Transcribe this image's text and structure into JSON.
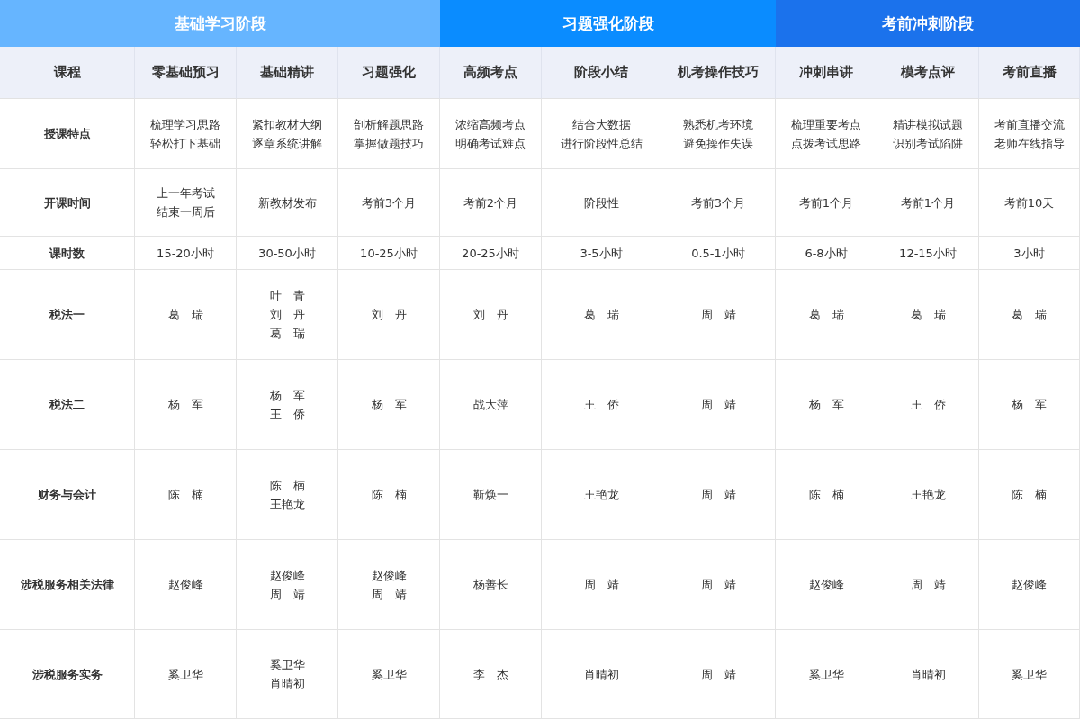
{
  "phases": [
    {
      "title": "基础学习阶段",
      "color": "#66b5ff",
      "columns": [
        "课程",
        "零基础预习",
        "基础精讲",
        "习题强化"
      ]
    },
    {
      "title": "习题强化阶段",
      "color": "#0a8cff",
      "columns": [
        "高频考点",
        "阶段小结",
        "机考操作技巧"
      ]
    },
    {
      "title": "考前冲刺阶段",
      "color": "#1b72ec",
      "columns": [
        "冲刺串讲",
        "模考点评",
        "考前直播"
      ]
    }
  ],
  "rows": [
    {
      "label": "授课特点",
      "cells": [
        [
          "梳理学习思路",
          "轻松打下基础"
        ],
        [
          "紧扣教材大纲",
          "逐章系统讲解"
        ],
        [
          "剖析解题思路",
          "掌握做题技巧"
        ],
        [
          "浓缩高频考点",
          "明确考试难点"
        ],
        [
          "结合大数据",
          "进行阶段性总结"
        ],
        [
          "熟悉机考环境",
          "避免操作失误"
        ],
        [
          "梳理重要考点",
          "点拨考试思路"
        ],
        [
          "精讲模拟试题",
          "识别考试陷阱"
        ],
        [
          "考前直播交流",
          "老师在线指导"
        ]
      ]
    },
    {
      "label": "开课时间",
      "cells": [
        [
          "上一年考试",
          "结束一周后"
        ],
        [
          "新教材发布"
        ],
        [
          "考前3个月"
        ],
        [
          "考前2个月"
        ],
        [
          "阶段性"
        ],
        [
          "考前3个月"
        ],
        [
          "考前1个月"
        ],
        [
          "考前1个月"
        ],
        [
          "考前10天"
        ]
      ]
    },
    {
      "label": "课时数",
      "cells": [
        [
          "15-20小时"
        ],
        [
          "30-50小时"
        ],
        [
          "10-25小时"
        ],
        [
          "20-25小时"
        ],
        [
          "3-5小时"
        ],
        [
          "0.5-1小时"
        ],
        [
          "6-8小时"
        ],
        [
          "12-15小时"
        ],
        [
          "3小时"
        ]
      ]
    },
    {
      "label": "税法一",
      "cells": [
        [
          "葛　瑞"
        ],
        [
          "叶　青",
          "刘　丹",
          "葛　瑞"
        ],
        [
          "刘　丹"
        ],
        [
          "刘　丹"
        ],
        [
          "葛　瑞"
        ],
        [
          "周　靖"
        ],
        [
          "葛　瑞"
        ],
        [
          "葛　瑞"
        ],
        [
          "葛　瑞"
        ]
      ]
    },
    {
      "label": "税法二",
      "cells": [
        [
          "杨　军"
        ],
        [
          "杨　军",
          "王　侨"
        ],
        [
          "杨　军"
        ],
        [
          "战大萍"
        ],
        [
          "王　侨"
        ],
        [
          "周　靖"
        ],
        [
          "杨　军"
        ],
        [
          "王　侨"
        ],
        [
          "杨　军"
        ]
      ]
    },
    {
      "label": "财务与会计",
      "cells": [
        [
          "陈　楠"
        ],
        [
          "陈　楠",
          "王艳龙"
        ],
        [
          "陈　楠"
        ],
        [
          "靳焕一"
        ],
        [
          "王艳龙"
        ],
        [
          "周　靖"
        ],
        [
          "陈　楠"
        ],
        [
          "王艳龙"
        ],
        [
          "陈　楠"
        ]
      ]
    },
    {
      "label": "涉税服务相关法律",
      "cells": [
        [
          "赵俊峰"
        ],
        [
          "赵俊峰",
          "周　靖"
        ],
        [
          "赵俊峰",
          "周　靖"
        ],
        [
          "杨善长"
        ],
        [
          "周　靖"
        ],
        [
          "周　靖"
        ],
        [
          "赵俊峰"
        ],
        [
          "周　靖"
        ],
        [
          "赵俊峰"
        ]
      ]
    },
    {
      "label": "涉税服务实务",
      "cells": [
        [
          "奚卫华"
        ],
        [
          "奚卫华",
          "肖晴初"
        ],
        [
          "奚卫华"
        ],
        [
          "李　杰"
        ],
        [
          "肖晴初"
        ],
        [
          "周　靖"
        ],
        [
          "奚卫华"
        ],
        [
          "肖晴初"
        ],
        [
          "奚卫华"
        ]
      ]
    }
  ]
}
